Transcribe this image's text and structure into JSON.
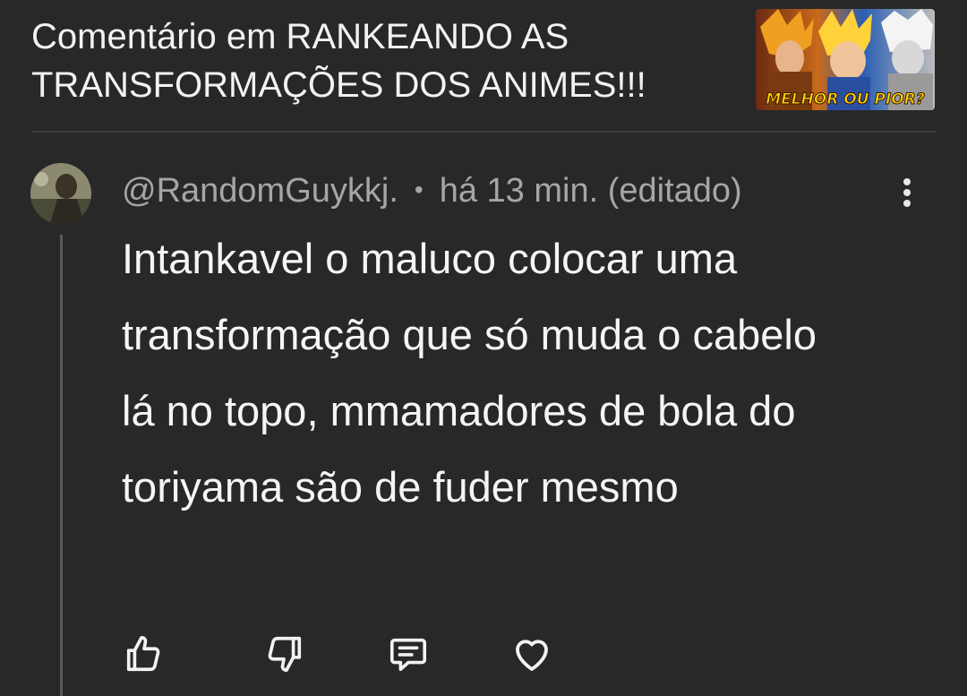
{
  "header": {
    "title": "Comentário em RANKEANDO AS TRANSFORMAÇÕES DOS ANIMES!!!",
    "thumbnail_caption": "MELHOR OU PIOR?"
  },
  "comment": {
    "author": "@RandomGuykkj.",
    "separator": "•",
    "time": "há 13 min. (editado)",
    "text": "Intankavel o maluco colocar uma transformação que só muda o cabelo lá no topo, mmamadores de bola do toriyama são de fuder mesmo"
  },
  "actions": {
    "like_icon": "thumbs-up-icon",
    "dislike_icon": "thumbs-down-icon",
    "reply_icon": "comment-icon",
    "heart_icon": "heart-icon"
  },
  "colors": {
    "background": "#282828",
    "meta_text": "#a6a6a6",
    "body_text": "#f5f5f5",
    "thread_line": "#5a5a5a"
  }
}
